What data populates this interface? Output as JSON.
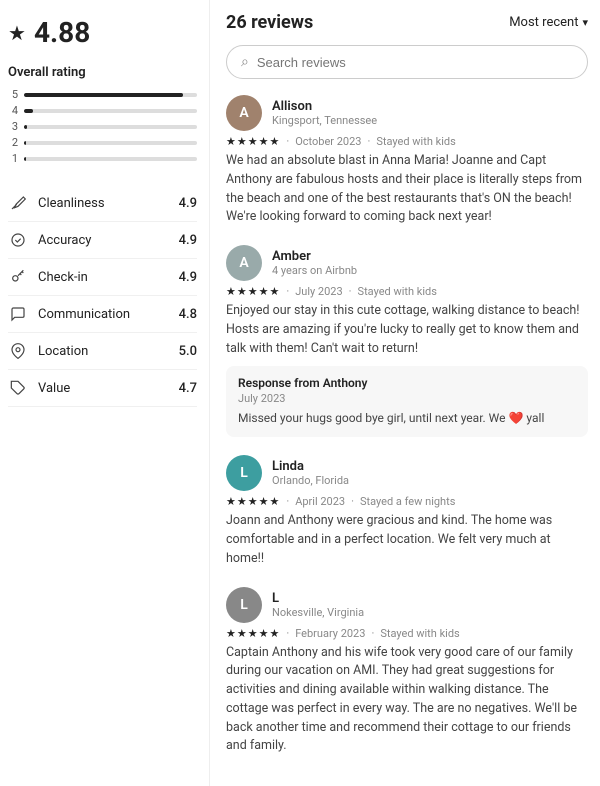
{
  "left": {
    "rating": "4.88",
    "overall_label": "Overall rating",
    "bars": [
      {
        "label": "5",
        "fill": 92
      },
      {
        "label": "4",
        "fill": 5
      },
      {
        "label": "3",
        "fill": 2
      },
      {
        "label": "2",
        "fill": 1
      },
      {
        "label": "1",
        "fill": 1
      }
    ],
    "categories": [
      {
        "icon": "broom",
        "name": "Cleanliness",
        "score": "4.9"
      },
      {
        "icon": "check-circle",
        "name": "Accuracy",
        "score": "4.9"
      },
      {
        "icon": "key",
        "name": "Check-in",
        "score": "4.9"
      },
      {
        "icon": "chat",
        "name": "Communication",
        "score": "4.8"
      },
      {
        "icon": "location",
        "name": "Location",
        "score": "5.0"
      },
      {
        "icon": "tag",
        "name": "Value",
        "score": "4.7"
      }
    ]
  },
  "right": {
    "reviews_count": "26 reviews",
    "sort_label": "Most recent",
    "search_placeholder": "Search reviews",
    "reviews": [
      {
        "id": "allison",
        "name": "Allison",
        "meta": "Kingsport, Tennessee",
        "avatar_letter": "A",
        "avatar_class": "avatar-brown",
        "stars": "★★★★★",
        "date": "October 2023",
        "stay_type": "Stayed with kids",
        "text": "We had an absolute blast in Anna Maria! Joanne and Capt Anthony are fabulous hosts and their place is literally steps from the beach and one of the best restaurants that's ON the beach! We're looking forward to coming back next year!",
        "response": null
      },
      {
        "id": "amber",
        "name": "Amber",
        "meta": "4 years on Airbnb",
        "avatar_letter": "A",
        "avatar_class": "avatar-gray",
        "stars": "★★★★★",
        "date": "July 2023",
        "stay_type": "Stayed with kids",
        "text": "Enjoyed our stay in this cute cottage, walking distance to beach! Hosts are amazing if you're lucky to really get to know them and talk with them! Can't wait to return!",
        "response": {
          "title": "Response from Anthony",
          "date": "July 2023",
          "text": "Missed your hugs good bye girl, until next year. We ❤️ yall"
        }
      },
      {
        "id": "linda",
        "name": "Linda",
        "meta": "Orlando, Florida",
        "avatar_letter": "L",
        "avatar_class": "avatar-teal",
        "stars": "★★★★★",
        "date": "April 2023",
        "stay_type": "Stayed a few nights",
        "text": "Joann and Anthony were gracious and kind. The home was comfortable and in a perfect location. We felt very much at home!!",
        "response": null
      },
      {
        "id": "l",
        "name": "L",
        "meta": "Nokesville, Virginia",
        "avatar_letter": "L",
        "avatar_class": "avatar-olive",
        "stars": "★★★★★",
        "date": "February 2023",
        "stay_type": "Stayed with kids",
        "text": "Captain Anthony and his wife took very good care of our family during our vacation on AMI. They had great suggestions for activities and dining available within walking distance. The cottage was perfect in every way. The are no negatives. We'll be back another time and recommend their cottage to our friends and family.",
        "response": null
      }
    ]
  }
}
